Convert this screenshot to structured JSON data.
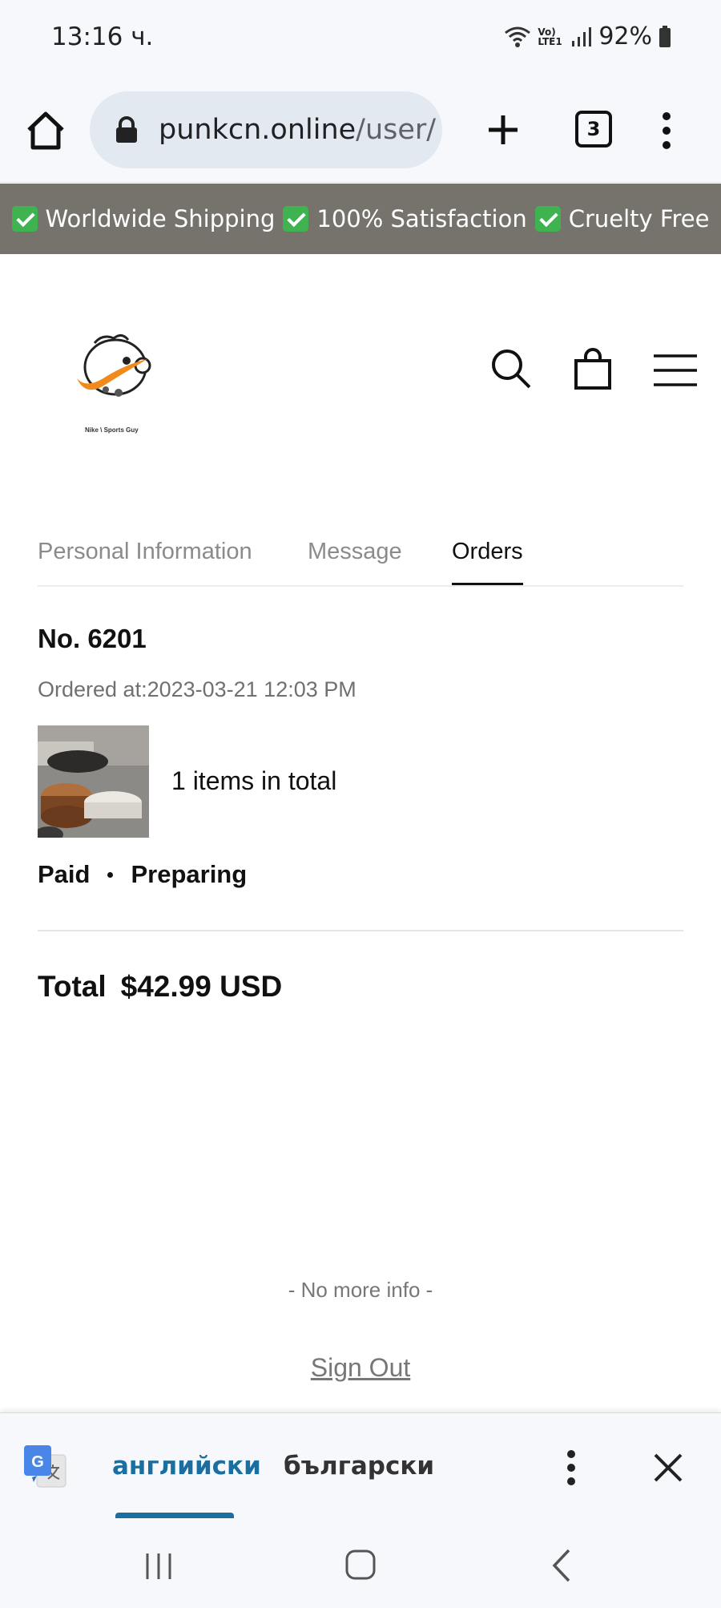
{
  "status_bar": {
    "time": "13:16 ч.",
    "battery": "92%",
    "network_label": "Vo) LTE1"
  },
  "browser": {
    "url_host": "punkcn.online",
    "url_path": "/user/",
    "tab_count": "3"
  },
  "promo_banner": {
    "items": [
      "Worldwide Shipping",
      "100% Satisfaction",
      "Cruelty Free"
    ]
  },
  "header": {
    "logo_caption": "Nike \\ Sports Guy"
  },
  "account_tabs": [
    {
      "label": "Personal Information",
      "active": false
    },
    {
      "label": "Message",
      "active": false
    },
    {
      "label": "Orders",
      "active": true
    }
  ],
  "order": {
    "number": "No. 6201",
    "ordered_at": "Ordered at:2023-03-21 12:03 PM",
    "items_total": "1 items in total",
    "payment_status": "Paid",
    "fulfillment_status": "Preparing",
    "total_label": "Total",
    "total_value": "$42.99 USD"
  },
  "footer": {
    "no_more": "- No more info -",
    "sign_out": "Sign Out"
  },
  "translate_bar": {
    "source_lang": "английски",
    "target_lang": "български"
  },
  "colors": {
    "promo_bg": "#76736d",
    "translate_accent": "#1a6fa0",
    "check_green": "#3fb34f"
  }
}
